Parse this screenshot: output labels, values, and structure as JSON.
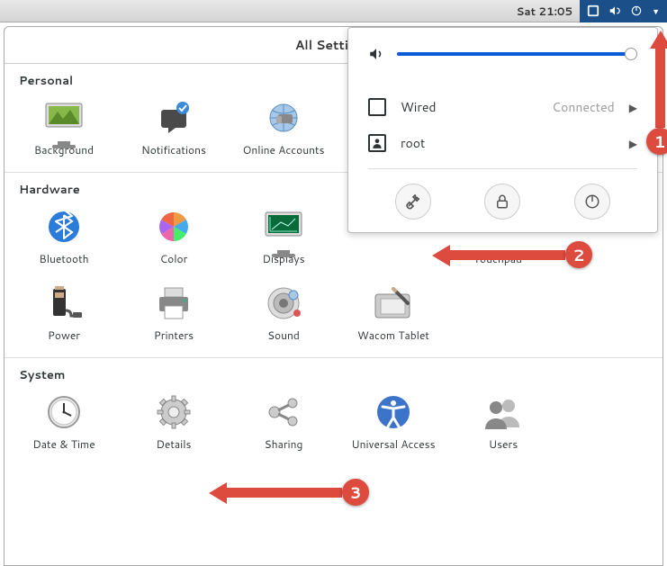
{
  "panel": {
    "clock": "Sat 21:05"
  },
  "window": {
    "title": "All Settings"
  },
  "sections": {
    "personal": {
      "heading": "Personal",
      "items": [
        "Background",
        "Notifications",
        "Online Accounts"
      ]
    },
    "hardware": {
      "heading": "Hardware",
      "row1": [
        "Bluetooth",
        "Color",
        "Displays",
        "Touchpad"
      ],
      "row2": [
        "Power",
        "Printers",
        "Sound",
        "Wacom Tablet"
      ]
    },
    "system": {
      "heading": "System",
      "items": [
        "Date & Time",
        "Details",
        "Sharing",
        "Universal Access",
        "Users"
      ]
    }
  },
  "status_menu": {
    "network_label": "Wired",
    "network_status": "Connected",
    "user": "root"
  },
  "annotations": {
    "a1": "1",
    "a2": "2",
    "a3": "3"
  }
}
